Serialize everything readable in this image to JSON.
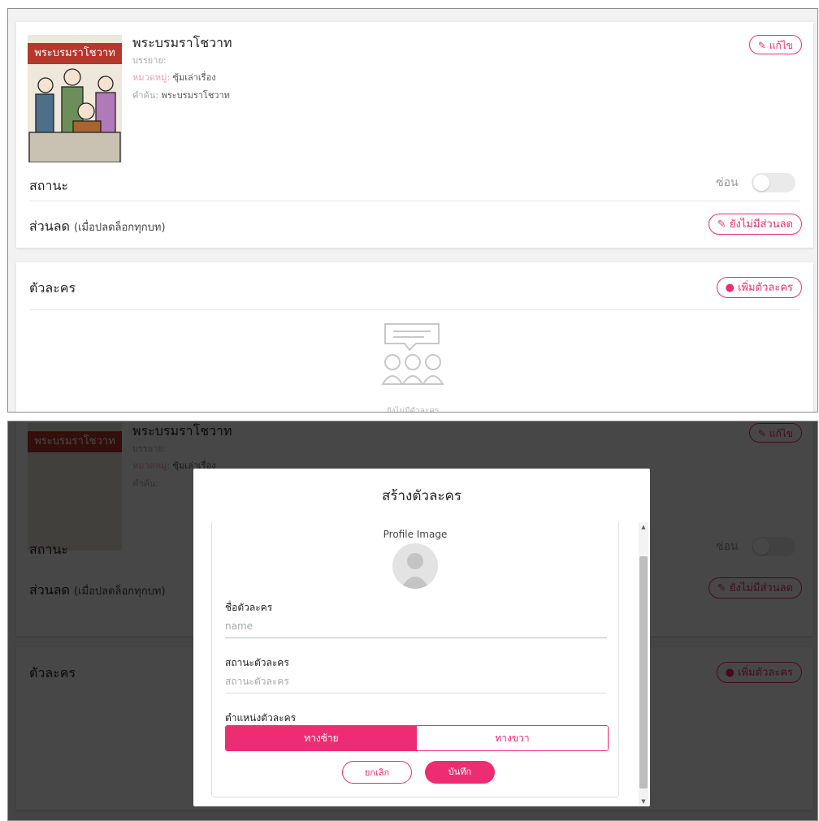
{
  "book": {
    "cover_banner": "พระบรมราโชวาท",
    "title": "พระบรมราโชวาท",
    "narrator_label": "บรรยาย:",
    "narrator_value": "",
    "category_label": "หมวดหมู่:",
    "category_value": "ซุ้มเล่าเรื่อง",
    "keyword_label": "คำค้น:",
    "keyword_value": "พระบรมราโชวาท",
    "edit_label": "แก้ไข"
  },
  "status": {
    "label": "สถานะ",
    "hide_label": "ซ่อน",
    "hidden": false
  },
  "discount": {
    "label": "ส่วนลด",
    "note": "(เมื่อปลดล็อกทุกบท)",
    "button": "ยังไม่มีส่วนลด"
  },
  "characters": {
    "label": "ตัวละคร",
    "add_button": "เพิ่มตัวละคร",
    "empty_text": "ยังไม่มีตัวละคร"
  },
  "modal": {
    "title": "สร้างตัวละคร",
    "profile_image_label": "Profile Image",
    "name_label": "ชื่อตัวละคร",
    "name_placeholder": "name",
    "status_label": "สถานะตัวละคร",
    "status_placeholder": "สถานะตัวละคร",
    "position_label": "ตำแหน่งตัวละคร",
    "position_options": [
      "ทางซ้าย",
      "ทางขวา"
    ],
    "position_selected": "ทางซ้าย",
    "cancel": "ยกเลิก",
    "save": "บันทึก"
  },
  "colors": {
    "accent": "#ee2c74",
    "overlay": "#000000"
  },
  "icons": [
    "pencil-icon",
    "plus-circle-icon",
    "chat-people-icon",
    "avatar-placeholder-icon"
  ]
}
